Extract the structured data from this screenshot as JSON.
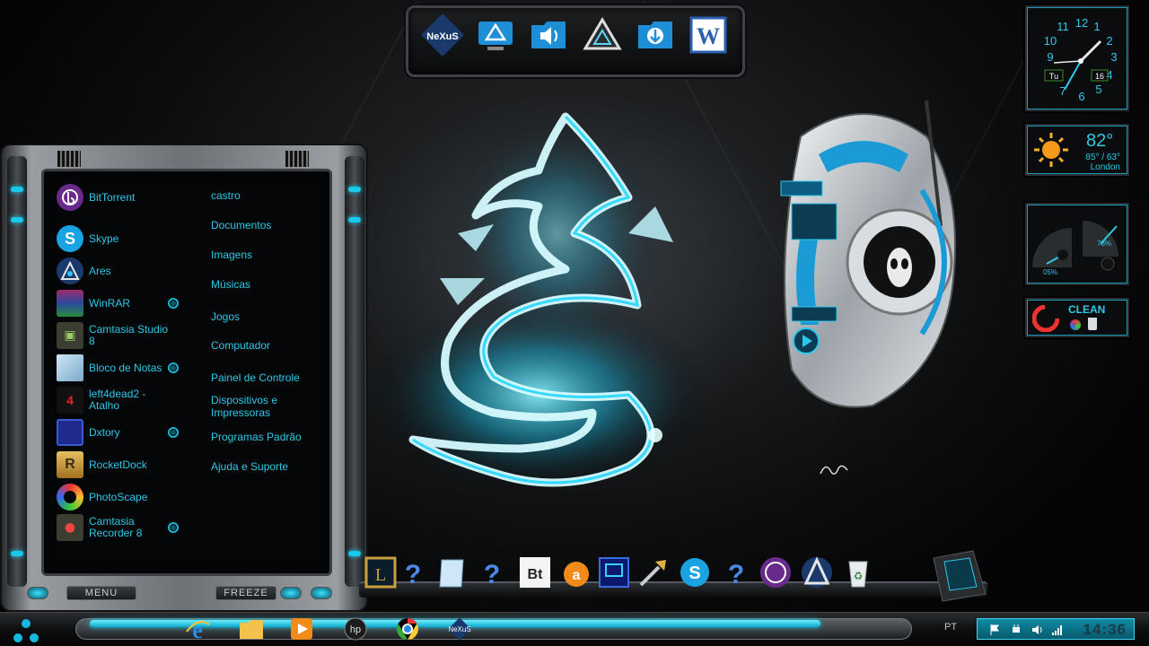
{
  "start_menu": {
    "programs": [
      {
        "label": "BitTorrent",
        "icon": "bittorrent-icon",
        "pinned": false
      },
      {
        "label": "Skype",
        "icon": "skype-icon",
        "pinned": false
      },
      {
        "label": "Ares",
        "icon": "ares-icon",
        "pinned": false
      },
      {
        "label": "WinRAR",
        "icon": "winrar-icon",
        "pinned": true
      },
      {
        "label": "Camtasia Studio 8",
        "icon": "camtasia-studio-icon",
        "pinned": true
      },
      {
        "label": "Bloco de Notas",
        "icon": "notepad-icon",
        "pinned": true
      },
      {
        "label": "left4dead2 - Atalho",
        "icon": "left4dead2-icon",
        "pinned": false
      },
      {
        "label": "Dxtory",
        "icon": "dxtory-icon",
        "pinned": true
      },
      {
        "label": "RocketDock",
        "icon": "rocketdock-icon",
        "pinned": false
      },
      {
        "label": "PhotoScape",
        "icon": "photoscape-icon",
        "pinned": false
      },
      {
        "label": "Camtasia Recorder 8",
        "icon": "camtasia-recorder-icon",
        "pinned": true
      }
    ],
    "places": [
      "castro",
      "Documentos",
      "Imagens",
      "Músicas",
      "Jogos",
      "Computador",
      "Painel de Controle",
      "Dispositivos e Impressoras",
      "Programas Padrão",
      "Ajuda e Suporte"
    ],
    "menu_button": "MENU",
    "freeze_button": "FREEZE"
  },
  "top_dock": {
    "items": [
      "nexus-logo-icon",
      "control-panel-icon",
      "sound-folder-icon",
      "alienware-triangle-icon",
      "downloads-folder-icon",
      "microsoft-word-icon"
    ],
    "nexus_text": "NeXuS",
    "word_letter": "W"
  },
  "bottom_dock": {
    "items": [
      "league-of-legends-icon",
      "help-icon",
      "notepad-icon",
      "help-icon",
      "bittorrent-bt-icon",
      "avast-icon",
      "monitor-icon",
      "tools-icon",
      "skype-icon",
      "help-icon",
      "bittorrent-icon",
      "ares-icon",
      "recycle-bin-icon"
    ],
    "bt_text": "Bt"
  },
  "clock_gadget": {
    "numbers": [
      "12",
      "1",
      "2",
      "3",
      "4",
      "5",
      "6",
      "7",
      "8",
      "9",
      "10",
      "11"
    ],
    "day": "Tu",
    "date": "16"
  },
  "weather_gadget": {
    "temperature": "82°",
    "range": "85° / 63°",
    "city": "London"
  },
  "meter_gadget": {
    "left_value": "05%",
    "right_value": "78%"
  },
  "cleaner_gadget": {
    "label": "CLEAN"
  },
  "taskbar": {
    "items": [
      "start-orb-icon",
      "internet-explorer-icon",
      "file-explorer-icon",
      "media-player-icon",
      "hp-icon",
      "chrome-icon",
      "nexus-icon"
    ],
    "language": "PT",
    "time": "14:36",
    "hp_text": "hp",
    "nexus_text": "NeXuS"
  }
}
